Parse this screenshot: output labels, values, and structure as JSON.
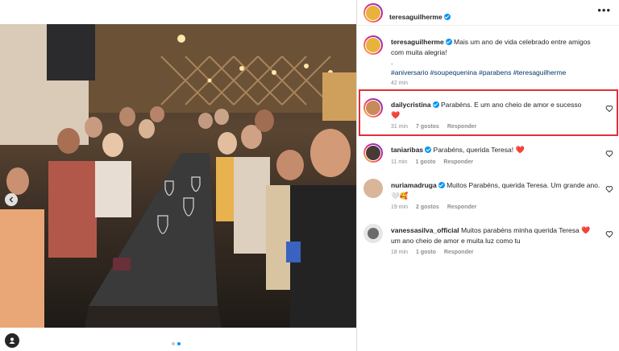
{
  "post": {
    "author": "teresaguilherme",
    "caption_text": "Mais um ano de vida celebrado entre amigos com muita alegria!",
    "caption_dot": ".",
    "hashtags": "#aniversario #soupequenina #parabens #teresaguilherme",
    "time": "42 min",
    "more_label": "•••"
  },
  "comments": [
    {
      "user": "dailycristina",
      "verified": true,
      "text": "Parabéns. E um ano cheio de amor e sucesso",
      "emoji": "❤️",
      "time": "31 min",
      "likes": "7 gostos",
      "reply": "Responder",
      "avatar_color": "#c98a5a"
    },
    {
      "user": "taniaribas",
      "verified": true,
      "text": "Parabéns, querida Teresa!",
      "emoji": "❤️",
      "time": "11 min",
      "likes": "1 gosto",
      "reply": "Responder",
      "avatar_color": "#4a3a36"
    },
    {
      "user": "nuriamadruga",
      "verified": true,
      "text": "Muitos Parabéns, querida Teresa. Um grande ano.",
      "emoji": "🤍🥰",
      "time": "19 min",
      "likes": "2 gostos",
      "reply": "Responder",
      "avatar_color": "#d9b59a"
    },
    {
      "user": "vanessasilva_official",
      "verified": false,
      "text": "Muitos parabéns minha querida Teresa",
      "text_cont": "um ano cheio de amor e muita luz como tu",
      "emoji": "❤️",
      "time": "18 min",
      "likes": "1 gosto",
      "reply": "Responder",
      "avatar_color": "#bdbdbd"
    }
  ],
  "colors": {
    "link": "#00376b",
    "meta": "#8e8e8e",
    "verified": "#0095f6",
    "highlight": "#e0303a",
    "heart": "#ed4956"
  },
  "icons": {
    "carousel_prev": "chevron-left-icon",
    "like": "heart-outline-icon",
    "tag": "person-tag-icon",
    "more": "more-horizontal-icon"
  }
}
